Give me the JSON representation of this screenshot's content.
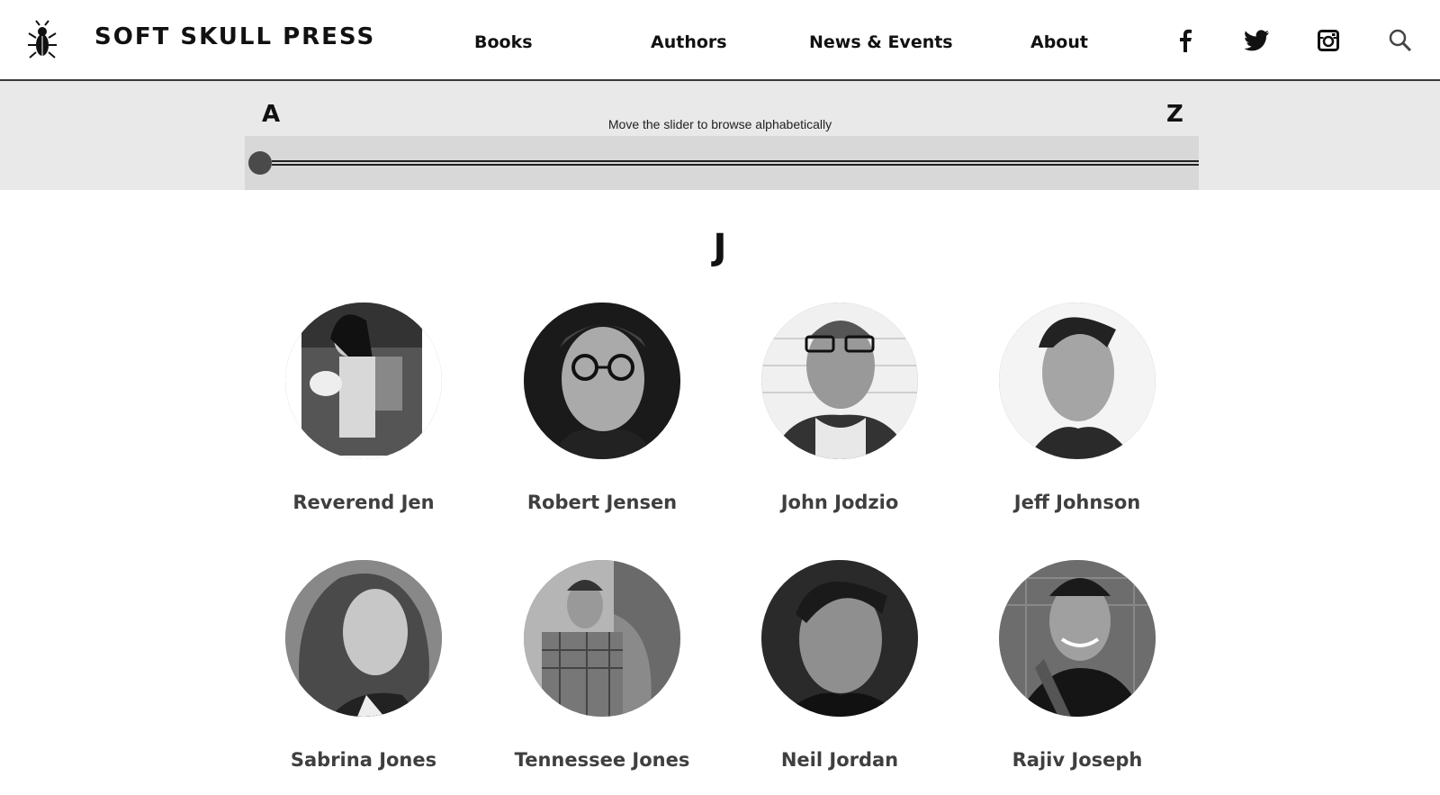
{
  "header": {
    "brand": "SOFT SKULL PRESS",
    "nav": [
      "Books",
      "Authors",
      "News & Events",
      "About"
    ],
    "social_icons": [
      "facebook-icon",
      "twitter-icon",
      "instagram-icon",
      "search-icon"
    ]
  },
  "slider": {
    "start_letter": "A",
    "end_letter": "Z",
    "hint": "Move the slider to browse alphabetically",
    "position": 0
  },
  "section": {
    "letter": "J",
    "authors": [
      {
        "name": "Reverend Jen"
      },
      {
        "name": "Robert Jensen"
      },
      {
        "name": "John Jodzio"
      },
      {
        "name": "Jeff Johnson"
      },
      {
        "name": "Sabrina Jones"
      },
      {
        "name": "Tennessee Jones"
      },
      {
        "name": "Neil Jordan"
      },
      {
        "name": "Rajiv Joseph"
      }
    ]
  }
}
